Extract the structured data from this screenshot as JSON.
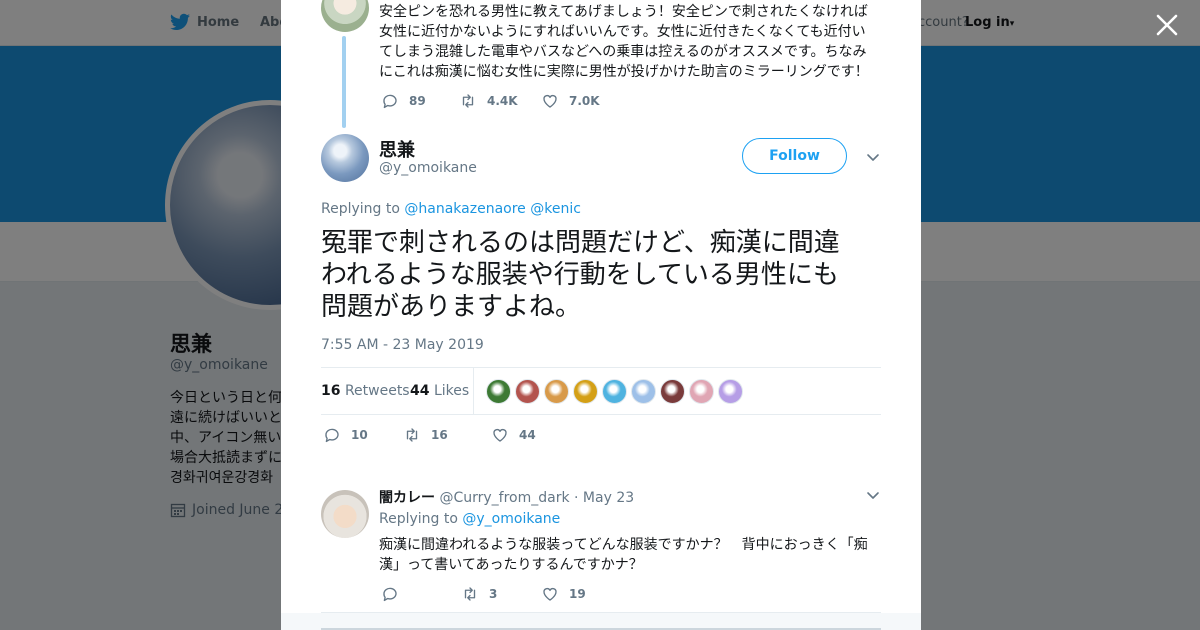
{
  "nav": {
    "home": "Home",
    "about_partial": "Abo",
    "account_partial": "ccount?",
    "login": "Log in"
  },
  "profile": {
    "name": "思兼",
    "handle": "@y_omoikane",
    "bio_lines": [
      "今日という日と何",
      "遠に続けばいいと",
      "中、アイコン無い",
      "場合大抵読まずに",
      "경화귀여운강경화"
    ],
    "joined": "Joined June 2"
  },
  "previous_tweet": {
    "text_lines": [
      "安全ピンを恐れる男性に教えてあげましょう！安全ピンで刺されたくなければ",
      "女性に近付かないようにすればいいんです。女性に近付きたくなくても近付い",
      "てしまう混雑した電車やバスなどへの乗車は控えるのがオススメです。ちなみ",
      "にこれは痴漢に悩む女性に実際に男性が投げかけた助言のミラーリングです！"
    ],
    "replies": "89",
    "retweets": "4.4K",
    "likes": "7.0K"
  },
  "main_tweet": {
    "name": "思兼",
    "handle": "@y_omoikane",
    "follow_label": "Follow",
    "replying_label": "Replying to",
    "replying_handles": [
      "@hanakazenaore",
      "@kenic"
    ],
    "text_lines": [
      "冤罪で刺されるのは問題だけど、痴漢に間違",
      "われるような服装や行動をしている男性にも",
      "問題がありますよね。"
    ],
    "timestamp": "7:55 AM - 23 May 2019",
    "retweet_count": "16",
    "retweet_label": "Retweets",
    "like_count": "44",
    "like_label": "Likes",
    "replies": "10",
    "retweets": "16",
    "likes": "44",
    "liker_avatar_colors": [
      "#3d7a34",
      "#b3544e",
      "#d89a4a",
      "#d4a017",
      "#4fb3e0",
      "#9ec0e8",
      "#7a3b3b",
      "#e0a6b4",
      "#b69ee6"
    ]
  },
  "reply_tweet": {
    "name": "闇カレー",
    "handle": "@Curry_from_dark",
    "date": "May 23",
    "replying_label": "Replying to",
    "replying_handle": "@y_omoikane",
    "text_lines": [
      "痴漢に間違われるような服装ってどんな服装ですかナ？　背中におっきく「痴",
      "漢」って書いてあったりするんですかナ？"
    ],
    "replies": "",
    "retweets": "3",
    "likes": "19"
  },
  "colors": {
    "accent": "#1da1f2",
    "banner": "#1b95e0",
    "overlay": "rgba(0,0,0,0.5)"
  }
}
